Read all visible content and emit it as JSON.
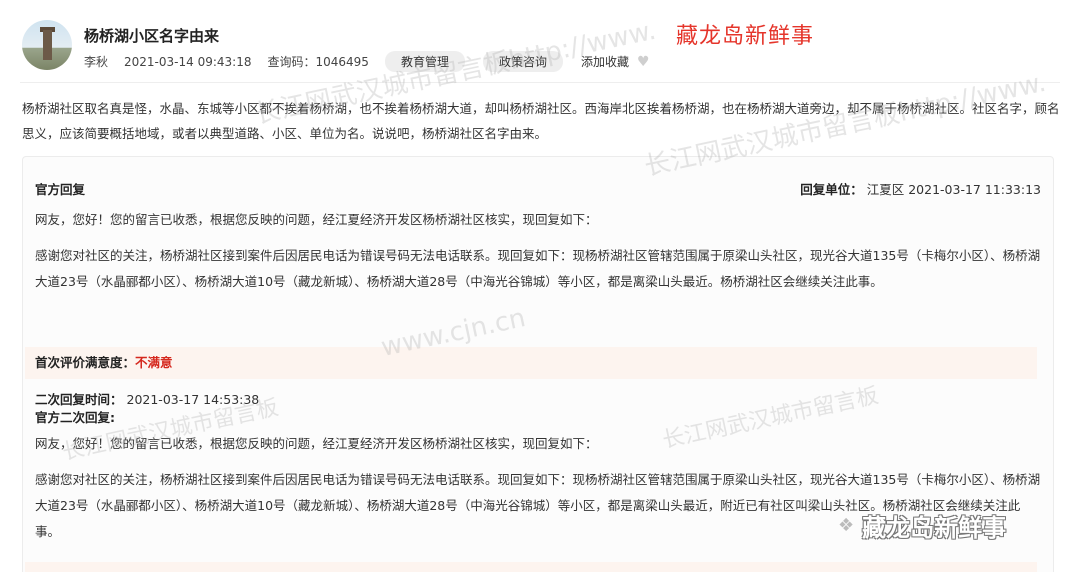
{
  "header": {
    "title": "杨桥湖小区名字由来",
    "author": "李秋",
    "datetime": "2021-03-14 09:43:18",
    "query_code_label": "查询码：",
    "query_code": "1046495",
    "tags": [
      "教育管理",
      "政策咨询"
    ],
    "favorite_label": "添加收藏",
    "brand": "藏龙岛新鲜事"
  },
  "question": "杨桥湖社区取名真是怪，水晶、东城等小区都不挨着杨桥湖，也不挨着杨桥湖大道，却叫杨桥湖社区。西海岸北区挨着杨桥湖，也在杨桥湖大道旁边，却不属于杨桥湖社区。社区名字，顾名思义，应该简要概括地域，或者以典型道路、小区、单位为名。说说吧，杨桥湖社区名字由来。",
  "reply": {
    "official_label": "官方回复",
    "unit_label": "回复单位：",
    "unit": "江夏区",
    "datetime": "2021-03-17 11:33:13",
    "greeting": "网友，您好！您的留言已收悉，根据您反映的问题，经江夏经济开发区杨桥湖社区核实，现回复如下：",
    "body": "感谢您对社区的关注，杨桥湖社区接到案件后因居民电话为错误号码无法电话联系。现回复如下：现杨桥湖社区管辖范围属于原梁山头社区，现光谷大道135号（卡梅尔小区）、杨桥湖大道23号（水晶郦都小区）、杨桥湖大道10号（藏龙新城）、杨桥湖大道28号（中海光谷锦城）等小区，都是离梁山头最近。杨桥湖社区会继续关注此事。",
    "satisfaction_label": "首次评价满意度：",
    "satisfaction_value": "不满意",
    "second_time_label": "二次回复时间：",
    "second_time": "2021-03-17 14:53:38",
    "second_label": "官方二次回复:",
    "second_greeting": "网友，您好！您的留言已收悉，根据您反映的问题，经江夏经济开发区杨桥湖社区核实，现回复如下：",
    "second_body": "感谢您对社区的关注，杨桥湖社区接到案件后因居民电话为错误号码无法电话联系。现回复如下：现杨桥湖社区管辖范围属于原梁山头社区，现光谷大道135号（卡梅尔小区）、杨桥湖大道23号（水晶郦都小区）、杨桥湖大道10号（藏龙新城）、杨桥湖大道28号（中海光谷锦城）等小区，都是离梁山头最近，附近已有社区叫梁山头社区。杨桥湖社区会继续关注此事。"
  },
  "watermarks": [
    "长江网武汉城市留言板http://www.",
    "长江网武汉城市留言板http://www.",
    "www.cjn.cn",
    "长江网武汉城市留言板",
    "长江网武汉城市留言板"
  ],
  "colors": {
    "brand_red": "#e5352b",
    "unsatisfied_red": "#d5281e",
    "satisfaction_bg": "#fdf4ef"
  },
  "icons": {
    "favorite": "heart-icon",
    "avatar": "tower-avatar",
    "wechat": "wechat-icon"
  }
}
